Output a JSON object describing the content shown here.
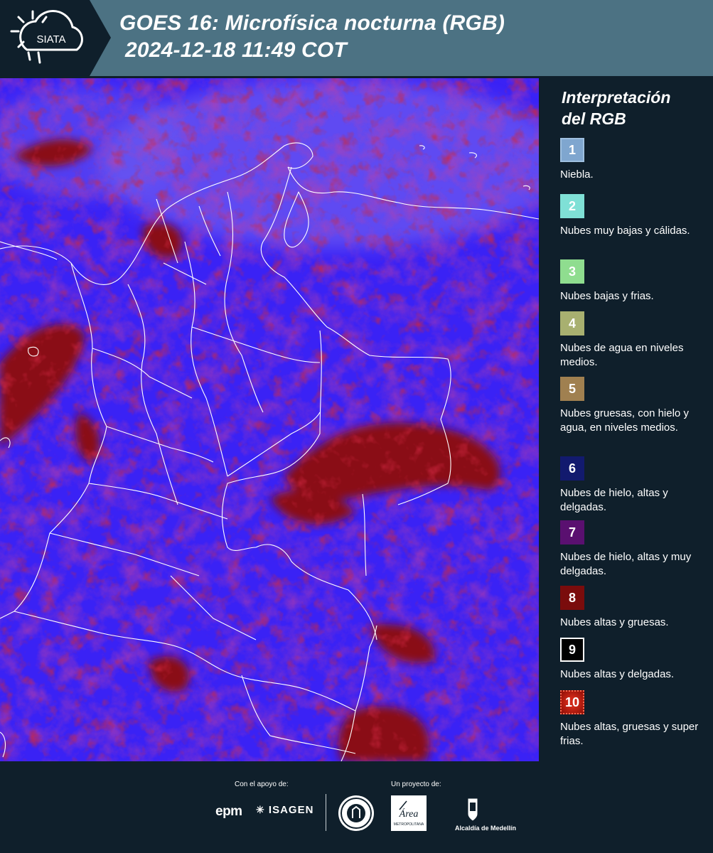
{
  "header": {
    "logo_text": "SIATA",
    "title_line1": "GOES 16: Microfísica nocturna (RGB)",
    "title_line2": "2024-12-18 11:49 COT"
  },
  "legend": {
    "title_line1": "Interpretación",
    "title_line2": "del RGB",
    "items": [
      {
        "num": "1",
        "color": "#7fa6cf",
        "label": "Niebla."
      },
      {
        "num": "2",
        "color": "#7fe0d6",
        "label": "Nubes muy bajas y cálidas."
      },
      {
        "num": "3",
        "color": "#8fdd8f",
        "label": "Nubes bajas y frias."
      },
      {
        "num": "4",
        "color": "#a8b070",
        "label": "Nubes de agua en niveles medios."
      },
      {
        "num": "5",
        "color": "#a08050",
        "label": "Nubes gruesas, con hielo y agua, en niveles medios."
      },
      {
        "num": "6",
        "color": "#121a6e",
        "label": "Nubes de hielo, altas y delgadas."
      },
      {
        "num": "7",
        "color": "#5a1070",
        "label": "Nubes de hielo, altas y muy delgadas."
      },
      {
        "num": "8",
        "color": "#7a0c0c",
        "label": "Nubes altas y gruesas."
      },
      {
        "num": "9",
        "color": "#000000",
        "label": "Nubes altas y delgadas."
      },
      {
        "num": "10",
        "color": "#b01810",
        "label": "Nubes altas, gruesas y super frias."
      }
    ]
  },
  "footer": {
    "support_label": "Con el apoyo de:",
    "project_label": "Un proyecto de:",
    "epm": "epm",
    "isagen": "ISAGEN",
    "amva_text": "Área",
    "amva_sub": "METROPOLITANA",
    "alcaldia": "Alcaldía de Medellín"
  }
}
